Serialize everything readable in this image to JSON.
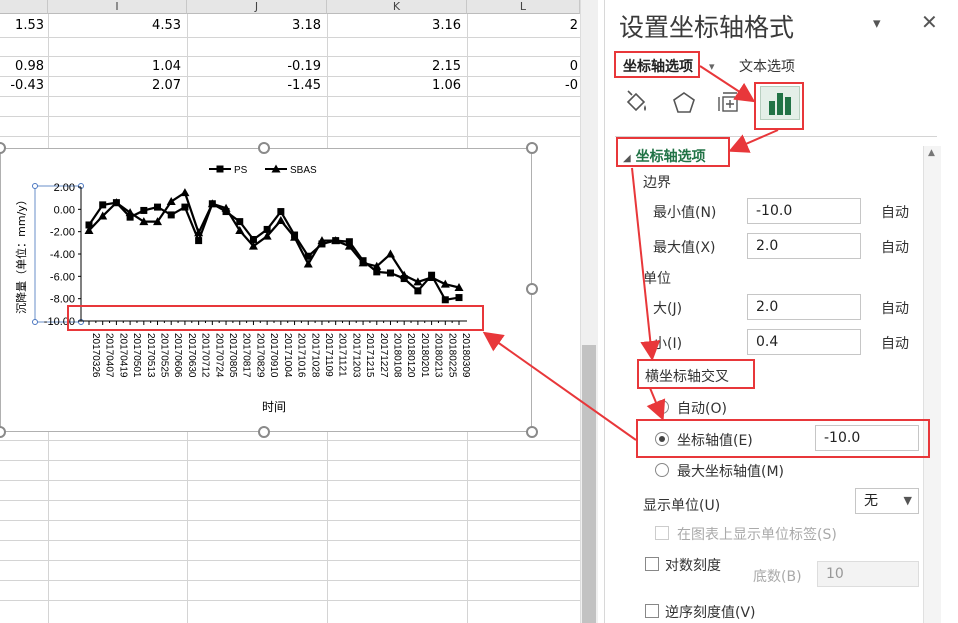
{
  "sheet": {
    "columns": [
      "I",
      "J",
      "K",
      "L"
    ],
    "rows": [
      {
        "h": "1.53",
        "i": "4.53",
        "j": "3.18",
        "k": "3.16",
        "l": "2"
      },
      {
        "h": "0.98",
        "i": "1.04",
        "j": "-0.19",
        "k": "2.15",
        "l": "0"
      },
      {
        "h": "-0.43",
        "i": "2.07",
        "j": "-1.45",
        "k": "1.06",
        "l": "-0"
      }
    ]
  },
  "chart_data": {
    "type": "line",
    "title": "",
    "xlabel": "时间",
    "ylabel": "沉降量（单位：mm/y）",
    "ylim": [
      -10,
      2
    ],
    "yticks": [
      "2.00",
      "0.00",
      "-2.00",
      "-4.00",
      "-6.00",
      "-8.00",
      "-10.00"
    ],
    "legend_placement": "top",
    "categories": [
      "20170326",
      "20170407",
      "20170419",
      "20170501",
      "20170513",
      "20170525",
      "20170606",
      "20170630",
      "20170712",
      "20170724",
      "20170805",
      "20170817",
      "20170829",
      "20170910",
      "20171004",
      "20171016",
      "20171028",
      "20171109",
      "20171121",
      "20171203",
      "20171215",
      "20171227",
      "20180108",
      "20180120",
      "20180201",
      "20180213",
      "20180225",
      "20180309"
    ],
    "series": [
      {
        "name": "PS",
        "marker": "square",
        "values": [
          -1.4,
          0.4,
          0.6,
          -0.7,
          -0.1,
          0.2,
          -0.5,
          0.2,
          -2.8,
          0.5,
          -0.2,
          -1.1,
          -2.7,
          -1.8,
          -0.2,
          -2.3,
          -4.2,
          -3.1,
          -2.8,
          -2.9,
          -4.6,
          -5.6,
          -5.7,
          -6.2,
          -7.3,
          -5.9,
          -8.1,
          -7.9
        ]
      },
      {
        "name": "SBAS",
        "marker": "triangle",
        "values": [
          -1.9,
          -0.6,
          0.6,
          -0.3,
          -1.1,
          -1.1,
          0.7,
          1.5,
          -2.1,
          0.5,
          0.1,
          -1.9,
          -3.3,
          -2.4,
          -1.0,
          -2.5,
          -4.9,
          -2.8,
          -2.8,
          -3.3,
          -4.8,
          -5.1,
          -4.0,
          -5.9,
          -6.5,
          -6.1,
          -6.7,
          -7.0
        ]
      }
    ]
  },
  "pane": {
    "title": "设置坐标轴格式",
    "tab_axis": "坐标轴选项",
    "tab_text": "文本选项",
    "section": "坐标轴选项",
    "bounds": "边界",
    "min_label": "最小值(N)",
    "min_value": "-10.0",
    "max_label": "最大值(X)",
    "max_value": "2.0",
    "units": "单位",
    "major_label": "大(J)",
    "major_value": "2.0",
    "minor_label": "小(I)",
    "minor_value": "0.4",
    "auto": "自动",
    "cross_label": "横坐标轴交叉",
    "cross_auto": "自动(O)",
    "cross_value_label": "坐标轴值(E)",
    "cross_value": "-10.0",
    "cross_max": "最大坐标轴值(M)",
    "display_units_label": "显示单位(U)",
    "display_units_value": "无",
    "show_units_label": "在图表上显示单位标签(S)",
    "log_label": "对数刻度",
    "base_label": "底数(B)",
    "base_value": "10",
    "reverse_label": "逆序刻度值(V)"
  },
  "icons": {
    "fill": "paint-bucket-icon",
    "effects": "pentagon-icon",
    "size": "size-properties-icon",
    "axis": "bar-chart-icon",
    "close": "close-icon",
    "dropdown": "chevron-down-icon"
  },
  "colors": {
    "accent": "#217346",
    "annotation": "#e8373a"
  }
}
